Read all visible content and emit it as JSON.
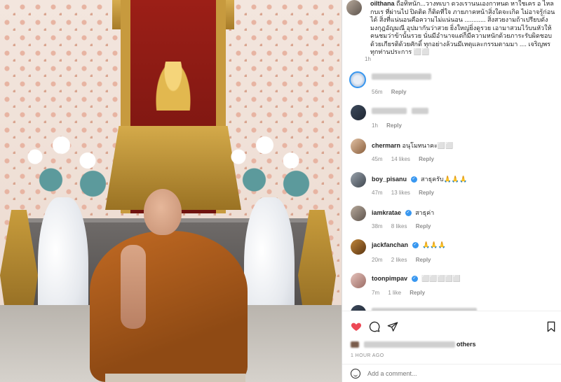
{
  "post": {
    "caption_user": "oilthana",
    "caption_text": "ถือทิหนัก...วางทเบา ดวงเรานนเองกาหนด หาใชเคร อ ไหลกบเร ที่ผ่านไป ปิดติด ก็ติดที่ใจ ภายภาคหน้าสิ่งใดจะเกิด ไม่อาจรู้ก่อนได้ สิ่งที่แน่นอนคือความไม่แน่นอน ............ สิ่งสวยงามถ้าเปรียบดั่งมงกุฎอัญมณี อุปมากันว่าสวย ยิ่งใหญ่ยิ่งดูรวย เอามาสวมไว้บนหัวให้คนชมว่าข้านั้นรวย นั่นมีอำนาจแต่ก็มีความหนักด้วยภาระรับผิดชอบด้วยเกียรติด้วยศักดิ์ ทุกอย่างล้วนมีเหตุและกรรมตามมา .... เจริญพรทุกท่านประการ ⬜⬜",
    "caption_time": "1h",
    "likes": "Liked by",
    "likes_suffix": "others",
    "time_ago": "1 HOUR AGO",
    "add_comment_placeholder": "Add a comment..."
  },
  "comments": [
    {
      "user": "",
      "text": "",
      "time": "56m",
      "likes": "",
      "reply": "Reply"
    },
    {
      "user": "",
      "text": "",
      "time": "1h",
      "likes": "",
      "reply": "Reply"
    },
    {
      "user": "chermarn",
      "verified": false,
      "text": "อนุโมทนาคะ⬜⬜",
      "time": "45m",
      "likes": "14 likes",
      "reply": "Reply"
    },
    {
      "user": "boy_pisanu",
      "verified": true,
      "text": "สาธุครับ🙏🙏🙏",
      "time": "47m",
      "likes": "13 likes",
      "reply": "Reply"
    },
    {
      "user": "iamkratae",
      "verified": true,
      "text": "สาธุค่า",
      "time": "38m",
      "likes": "8 likes",
      "reply": "Reply"
    },
    {
      "user": "jackfanchan",
      "verified": true,
      "text": "🙏🙏🙏",
      "time": "20m",
      "likes": "2 likes",
      "reply": "Reply"
    },
    {
      "user": "toonpimpav",
      "verified": true,
      "text": "⬜⬜⬜⬜⬜",
      "time": "7m",
      "likes": "1 like",
      "reply": "Reply"
    }
  ],
  "icons": {
    "heart": "heart-icon",
    "comment": "comment-icon",
    "share": "share-icon",
    "bookmark": "bookmark-icon",
    "emoji": "emoji-icon"
  },
  "colors": {
    "like": "#ed4956",
    "verified": "#3897f0",
    "muted": "#8e8e8e"
  }
}
